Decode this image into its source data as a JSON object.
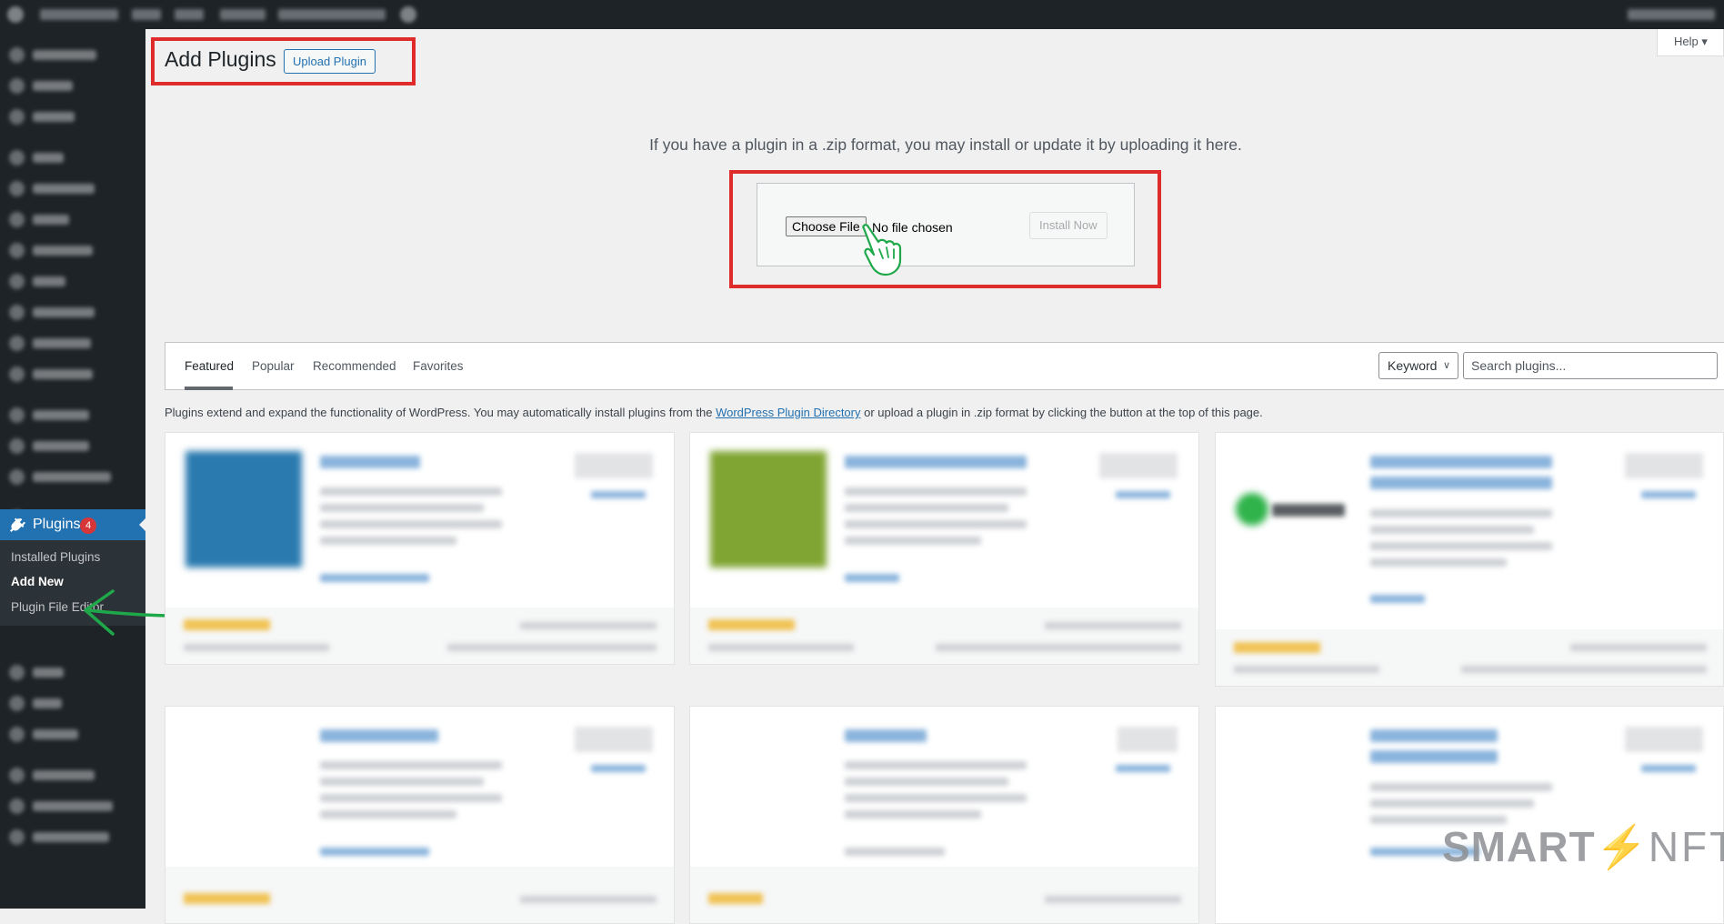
{
  "page": {
    "title": "Add Plugins",
    "upload_button": "Upload Plugin",
    "help_label": "Help ▾"
  },
  "sidebar": {
    "plugins_label": "Plugins",
    "plugins_badge": "4",
    "submenu": [
      "Installed Plugins",
      "Add New",
      "Plugin File Editor"
    ]
  },
  "upload": {
    "description": "If you have a plugin in a .zip format, you may install or update it by uploading it here.",
    "choose_file": "Choose File",
    "no_file": "No file chosen",
    "install_now": "Install Now"
  },
  "tabs": [
    "Featured",
    "Popular",
    "Recommended",
    "Favorites"
  ],
  "search": {
    "type_selected": "Keyword",
    "placeholder": "Search plugins..."
  },
  "intro": {
    "before": "Plugins extend and expand the functionality of WordPress. You may automatically install plugins from the ",
    "link": "WordPress Plugin Directory",
    "after": " or upload a plugin in .zip format by clicking the button at the top of this page."
  },
  "watermark": {
    "smart": "SMART",
    "nft": "NFT"
  },
  "colors": {
    "admin_dark": "#1d2327",
    "accent_blue": "#2271b1",
    "highlight_red": "#e02b2b",
    "arrow_green": "#1fa84a",
    "badge_red": "#d63638"
  }
}
